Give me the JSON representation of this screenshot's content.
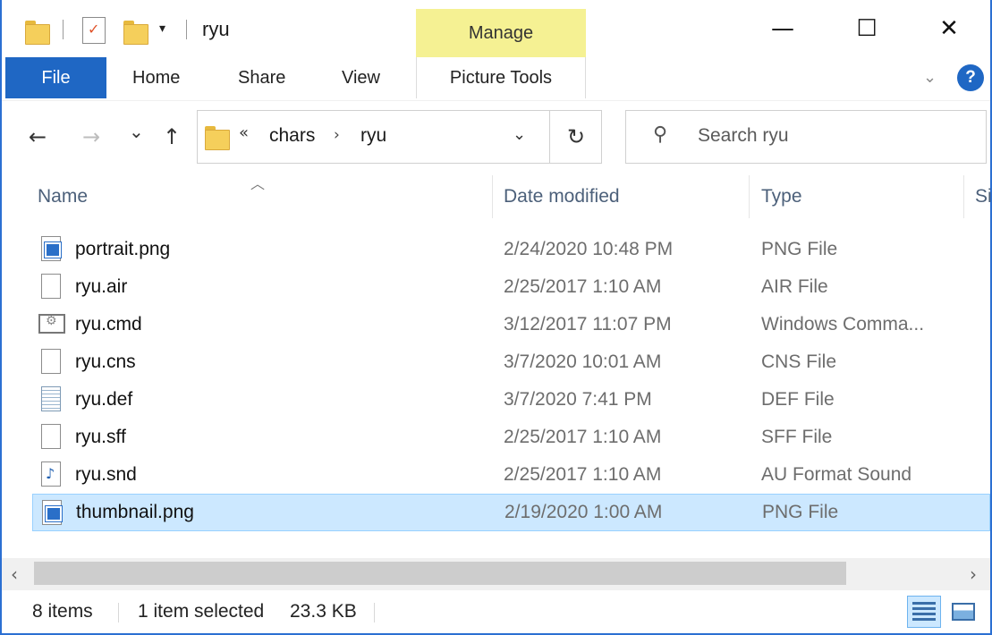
{
  "window": {
    "title": "ryu",
    "minimize_glyph": "—",
    "maximize_glyph": "☐",
    "close_glyph": "✕"
  },
  "ribbon": {
    "manage_label": "Manage",
    "file_tab": "File",
    "tabs": [
      "Home",
      "Share",
      "View"
    ],
    "picture_tools_tab": "Picture Tools",
    "help_glyph": "?"
  },
  "nav": {
    "back_glyph": "←",
    "forward_glyph": "→",
    "recent_glyph": "⌄",
    "up_glyph": "↑",
    "breadcrumb_more": "«",
    "breadcrumb": [
      "chars",
      "ryu"
    ],
    "refresh_glyph": "↻"
  },
  "search": {
    "placeholder": "Search ryu"
  },
  "columns": {
    "name": "Name",
    "date_modified": "Date modified",
    "type": "Type",
    "size_partial": "Si"
  },
  "files": [
    {
      "name": "portrait.png",
      "date": "2/24/2020 10:48 PM",
      "type": "PNG File",
      "icon": "image-file-icon"
    },
    {
      "name": "ryu.air",
      "date": "2/25/2017 1:10 AM",
      "type": "AIR File",
      "icon": "blank-file-icon"
    },
    {
      "name": "ryu.cmd",
      "date": "3/12/2017 11:07 PM",
      "type": "Windows Comma...",
      "icon": "command-file-icon"
    },
    {
      "name": "ryu.cns",
      "date": "3/7/2020 10:01 AM",
      "type": "CNS File",
      "icon": "blank-file-icon"
    },
    {
      "name": "ryu.def",
      "date": "3/7/2020 7:41 PM",
      "type": "DEF File",
      "icon": "notepad-file-icon"
    },
    {
      "name": "ryu.sff",
      "date": "2/25/2017 1:10 AM",
      "type": "SFF File",
      "icon": "blank-file-icon"
    },
    {
      "name": "ryu.snd",
      "date": "2/25/2017 1:10 AM",
      "type": "AU Format Sound",
      "icon": "sound-file-icon"
    },
    {
      "name": "thumbnail.png",
      "date": "2/19/2020 1:00 AM",
      "type": "PNG File",
      "icon": "image-file-icon",
      "selected": true
    }
  ],
  "status": {
    "item_count": "8 items",
    "selection": "1 item selected",
    "size": "23.3 KB"
  },
  "colors": {
    "accent": "#1f67c4",
    "manage_tab": "#f5f193",
    "selection_bg": "#cce8ff"
  }
}
